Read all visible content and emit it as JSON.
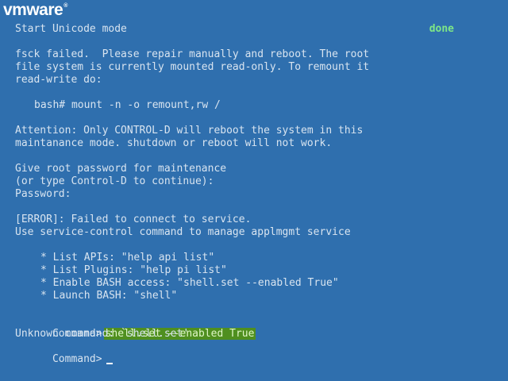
{
  "branding": {
    "logo_text": "vmware",
    "trademark": "®"
  },
  "console": {
    "line1_left": "Start Unicode mode",
    "line1_status": "done",
    "fsck_1": "fsck failed.  Please repair manually and reboot. The root",
    "fsck_2": "file system is currently mounted read-only. To remount it",
    "fsck_3": "read-write do:",
    "remount_cmd": "bash# mount -n -o remount,rw /",
    "attention_1": "Attention: Only CONTROL-D will reboot the system in this",
    "attention_2": "maintanance mode. shutdown or reboot will not work.",
    "password_1": "Give root password for maintenance",
    "password_2": "(or type Control-D to continue):",
    "password_3": "Password:",
    "error_1": "[ERROR]: Failed to connect to service.",
    "error_2": "Use service-control command to manage applmgmt service",
    "bullets": [
      "* List APIs: \"help api list\"",
      "* List Plugins: \"help pi list\"",
      "* Enable BASH access: \"shell.set --enabled True\"",
      "* Launch BASH: \"shell\""
    ],
    "command_prompt": "Command>",
    "command_value": "shell.set --enabled True",
    "unknown_command": "Unknown command: `shell.set'",
    "command_prompt_2": "Command>"
  },
  "colors": {
    "background": "#2f6fae",
    "foreground": "#d8e4f0",
    "status_done": "#7ee787",
    "highlight_bg": "#4f8f1f",
    "highlight_fg": "#dff7c6",
    "cursor": "#ffffff"
  }
}
